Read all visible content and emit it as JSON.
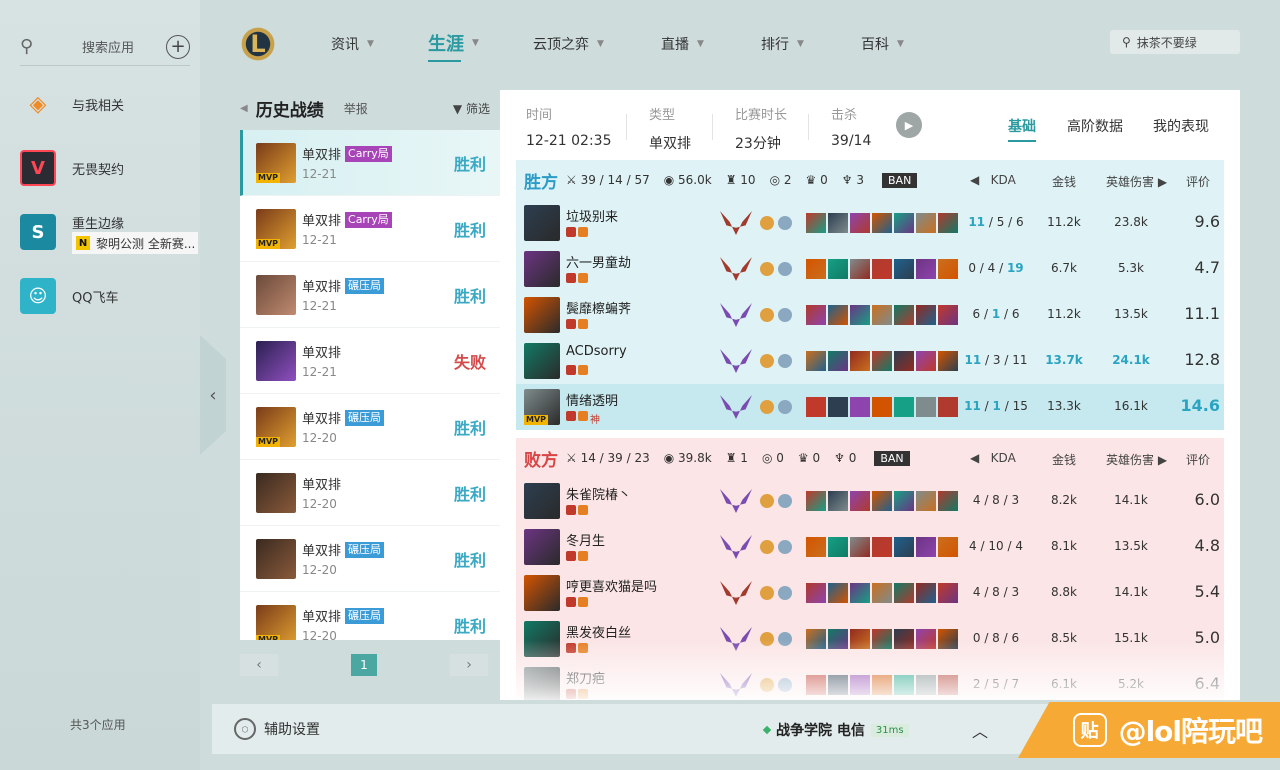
{
  "apps": {
    "search": "搜索应用",
    "items": [
      {
        "name": "与我相关"
      },
      {
        "name": "无畏契约"
      },
      {
        "name": "重生边缘",
        "sub": "黎明公测 全新赛..."
      },
      {
        "name": "QQ飞车"
      }
    ],
    "footer": "共3个应用"
  },
  "nav": [
    {
      "label": "资讯"
    },
    {
      "label": "生涯"
    },
    {
      "label": "云顶之弈"
    },
    {
      "label": "直播"
    },
    {
      "label": "排行"
    },
    {
      "label": "百科"
    }
  ],
  "top_search": {
    "placeholder": "抹茶不要绿"
  },
  "history": {
    "title": "历史战绩",
    "report": "举报",
    "filter": "筛选",
    "matches": [
      {
        "mode": "单双排",
        "tag": "Carry局",
        "tag_type": "carry",
        "date": "12-21",
        "result": "胜利",
        "mvp": true
      },
      {
        "mode": "单双排",
        "tag": "Carry局",
        "tag_type": "carry",
        "date": "12-21",
        "result": "胜利",
        "mvp": true
      },
      {
        "mode": "单双排",
        "tag": "碾压局",
        "tag_type": "crush",
        "date": "12-21",
        "result": "胜利",
        "mvp": false
      },
      {
        "mode": "单双排",
        "tag": "",
        "tag_type": "",
        "date": "12-21",
        "result": "失败",
        "mvp": false
      },
      {
        "mode": "单双排",
        "tag": "碾压局",
        "tag_type": "crush",
        "date": "12-20",
        "result": "胜利",
        "mvp": true
      },
      {
        "mode": "单双排",
        "tag": "",
        "tag_type": "",
        "date": "12-20",
        "result": "胜利",
        "mvp": false
      },
      {
        "mode": "单双排",
        "tag": "碾压局",
        "tag_type": "crush",
        "date": "12-20",
        "result": "胜利",
        "mvp": false
      },
      {
        "mode": "单双排",
        "tag": "碾压局",
        "tag_type": "crush",
        "date": "12-20",
        "result": "胜利",
        "mvp": true
      }
    ],
    "page": "1",
    "mvp_label": "MVP"
  },
  "summary": {
    "time_label": "时间",
    "time": "12-21 02:35",
    "type_label": "类型",
    "type": "单双排",
    "dur_label": "比赛时长",
    "dur": "23分钟",
    "kill_label": "击杀",
    "kill": "39/14"
  },
  "tabs": [
    "基础",
    "高阶数据",
    "我的表现"
  ],
  "columns": {
    "kda": "KDA",
    "gold": "金钱",
    "dmg": "英雄伤害",
    "score": "评价"
  },
  "win_team": {
    "name": "胜方",
    "kda": "39 / 14 / 57",
    "gold": "56.0k",
    "towers": "10",
    "inhib": "2",
    "baron": "0",
    "dragon": "3",
    "ban": "BAN",
    "players": [
      {
        "name": "垃圾别来",
        "k": "11",
        "d": "5",
        "a": "6",
        "gold": "11.2k",
        "dmg": "23.8k",
        "score": "9.6",
        "hl_k": true
      },
      {
        "name": "六一男童劫",
        "k": "0",
        "d": "4",
        "a": "19",
        "gold": "6.7k",
        "dmg": "5.3k",
        "score": "4.7",
        "hl_a": true
      },
      {
        "name": "鬓靡檫蝙荠",
        "k": "6",
        "d": "1",
        "a": "6",
        "gold": "11.2k",
        "dmg": "13.5k",
        "score": "11.1",
        "hl_d": true
      },
      {
        "name": "ACDsorry",
        "k": "11",
        "d": "3",
        "a": "11",
        "gold": "13.7k",
        "dmg": "24.1k",
        "score": "12.8",
        "hl_k": true,
        "hl_gold": true,
        "hl_dmg": true
      },
      {
        "name": "情绪透明",
        "k": "11",
        "d": "1",
        "a": "15",
        "gold": "13.3k",
        "dmg": "16.1k",
        "score": "14.6",
        "hl_k": true,
        "hl_d": true,
        "hl_score": true,
        "self": true,
        "mvp": true,
        "tag": "神"
      }
    ]
  },
  "lose_team": {
    "name": "败方",
    "kda": "14 / 39 / 23",
    "gold": "39.8k",
    "towers": "1",
    "inhib": "0",
    "baron": "0",
    "dragon": "0",
    "ban": "BAN",
    "players": [
      {
        "name": "朱雀院椿丶",
        "k": "4",
        "d": "8",
        "a": "3",
        "gold": "8.2k",
        "dmg": "14.1k",
        "score": "6.0"
      },
      {
        "name": "冬月生",
        "k": "4",
        "d": "10",
        "a": "4",
        "gold": "8.1k",
        "dmg": "13.5k",
        "score": "4.8"
      },
      {
        "name": "哼更喜欢猫是吗",
        "k": "4",
        "d": "8",
        "a": "3",
        "gold": "8.8k",
        "dmg": "14.1k",
        "score": "5.4"
      },
      {
        "name": "黑发夜白丝",
        "k": "0",
        "d": "8",
        "a": "6",
        "gold": "8.5k",
        "dmg": "15.1k",
        "score": "5.0"
      },
      {
        "name": "郑刀疤",
        "k": "2",
        "d": "5",
        "a": "7",
        "gold": "6.1k",
        "dmg": "5.2k",
        "score": "6.4"
      }
    ]
  },
  "bottom": {
    "assist": "辅助设置",
    "server": "战争学院 电信",
    "ping": "31ms",
    "watermark": "@lol陪玩吧",
    "wm_icon": "贴"
  }
}
